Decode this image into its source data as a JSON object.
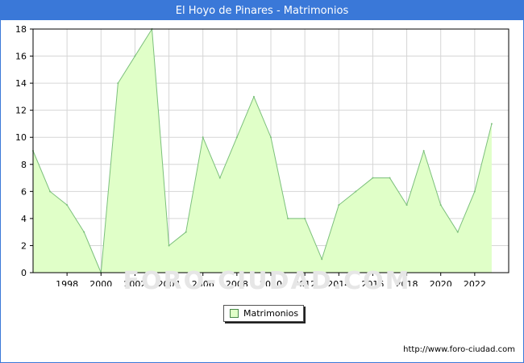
{
  "window": {
    "title": "El Hoyo de Pinares - Matrimonios"
  },
  "footer": {
    "source_url": "http://www.foro-ciudad.com"
  },
  "watermark": {
    "text": "FORO-CIUDAD.COM"
  },
  "colors": {
    "header": "#3a78d8",
    "fill": "#e0ffc8",
    "line": "#7cc07c",
    "grid": "#d6d6d6"
  },
  "chart_data": {
    "type": "area",
    "title": "El Hoyo de Pinares - Matrimonios",
    "xlabel": "",
    "ylabel": "",
    "xlim": [
      1996,
      2024
    ],
    "ylim": [
      0,
      18
    ],
    "x_ticks": [
      1998,
      2000,
      2002,
      2004,
      2006,
      2008,
      2010,
      2012,
      2014,
      2016,
      2018,
      2020,
      2022
    ],
    "y_ticks": [
      0,
      2,
      4,
      6,
      8,
      10,
      12,
      14,
      16,
      18
    ],
    "grid": true,
    "legend_position": "bottom-center",
    "series": [
      {
        "name": "Matrimonios",
        "x": [
          1996,
          1997,
          1998,
          1999,
          2000,
          2001,
          2002,
          2003,
          2004,
          2005,
          2006,
          2007,
          2008,
          2009,
          2010,
          2011,
          2012,
          2013,
          2014,
          2015,
          2016,
          2017,
          2018,
          2019,
          2020,
          2021,
          2022,
          2023
        ],
        "values": [
          9,
          6,
          5,
          3,
          0,
          14,
          16,
          18,
          2,
          3,
          10,
          7,
          10,
          13,
          10,
          4,
          4,
          1,
          5,
          6,
          7,
          7,
          5,
          9,
          5,
          3,
          6,
          11
        ]
      }
    ]
  }
}
